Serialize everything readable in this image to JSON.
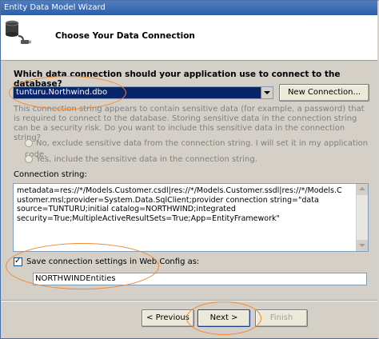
{
  "window": {
    "title": "Entity Data Model Wizard"
  },
  "header": {
    "title": "Choose Your Data Connection",
    "icon": "database-plug-icon"
  },
  "question": "Which data connection should your application use to connect to the database?",
  "connection": {
    "selected": "tunturu.Northwind.dbo",
    "new_connection_label": "New Connection..."
  },
  "sensitive_info": "This connection string appears to contain sensitive data (for example, a password) that is required to connect to the database. Storing sensitive data in the connection string can be a security risk. Do you want to include this sensitive data in the connection string?",
  "radios": [
    {
      "label": "No, exclude sensitive data from the connection string. I will set it in my application code."
    },
    {
      "label": "Yes, include the sensitive data in the connection string."
    }
  ],
  "connection_string": {
    "label": "Connection string:",
    "value": "metadata=res://*/Models.Customer.csdl|res://*/Models.Customer.ssdl|res://*/Models.Customer.msl;provider=System.Data.SqlClient;provider connection string=\"data source=TUNTURU;initial catalog=NORTHWIND;integrated security=True;MultipleActiveResultSets=True;App=EntityFramework\""
  },
  "save_settings": {
    "label": "Save connection settings in Web.Config as:",
    "checked": true,
    "value": "NORTHWINDEntities"
  },
  "footer": {
    "previous_label": "< Previous",
    "next_label": "Next >",
    "finish_label": "Finish"
  },
  "colors": {
    "annotation": "#f5882b",
    "selection": "#0a246a"
  }
}
